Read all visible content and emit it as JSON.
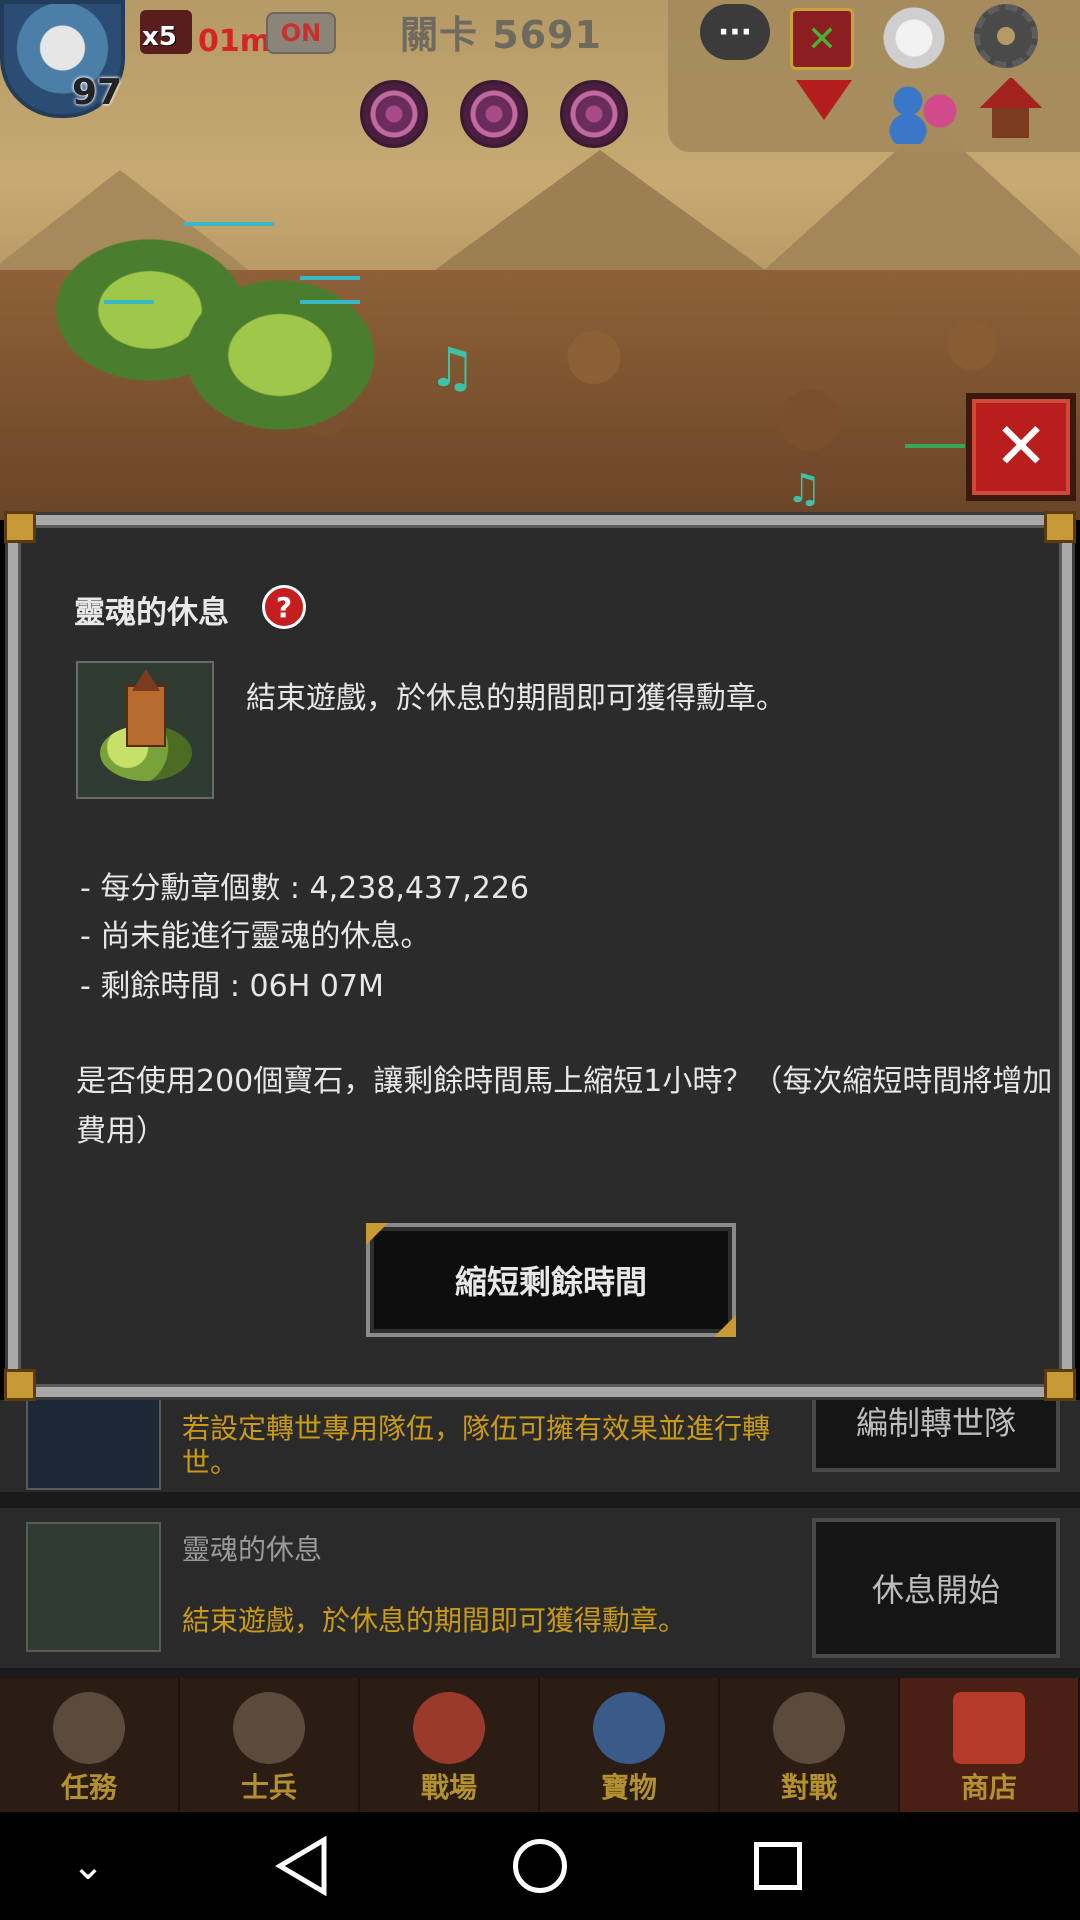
{
  "hud": {
    "player_level": "97",
    "buff_count": "x5",
    "buff_time": "01m",
    "on_badge": "ON",
    "stage": "關卡 5691"
  },
  "icons": [
    "chat-icon",
    "quest-icon",
    "angel-icon",
    "gear-icon",
    "dropdown-arrow-icon",
    "friends-icon",
    "house-icon"
  ],
  "close_label": "✕",
  "modal": {
    "title": "靈魂的休息",
    "help": "?",
    "description": "結束遊戲，於休息的期間即可獲得勳章。",
    "stats": [
      "- 每分勳章個數 : 4,238,437,226",
      "- 尚未能進行靈魂的休息。",
      "- 剩餘時間 : 06H 07M"
    ],
    "question": "是否使用200個寶石，讓剩餘時間馬上縮短1小時？（每次縮短時間將增加費用）",
    "action_button": "縮短剩餘時間"
  },
  "background_list": {
    "row1_text": "若設定轉世專用隊伍，隊伍可擁有效果並進行轉世。",
    "row1_button": "編制轉世隊",
    "row2_title": "靈魂的休息",
    "row2_text": "結束遊戲，於休息的期間即可獲得勳章。",
    "row2_button": "休息開始"
  },
  "bottom_nav": [
    {
      "label": "任務"
    },
    {
      "label": "士兵"
    },
    {
      "label": "戰場"
    },
    {
      "label": "寶物"
    },
    {
      "label": "對戰"
    },
    {
      "label": "商店",
      "active": true
    }
  ],
  "system_nav": [
    "chevron-down-icon",
    "back-icon",
    "home-icon",
    "recent-apps-icon"
  ]
}
